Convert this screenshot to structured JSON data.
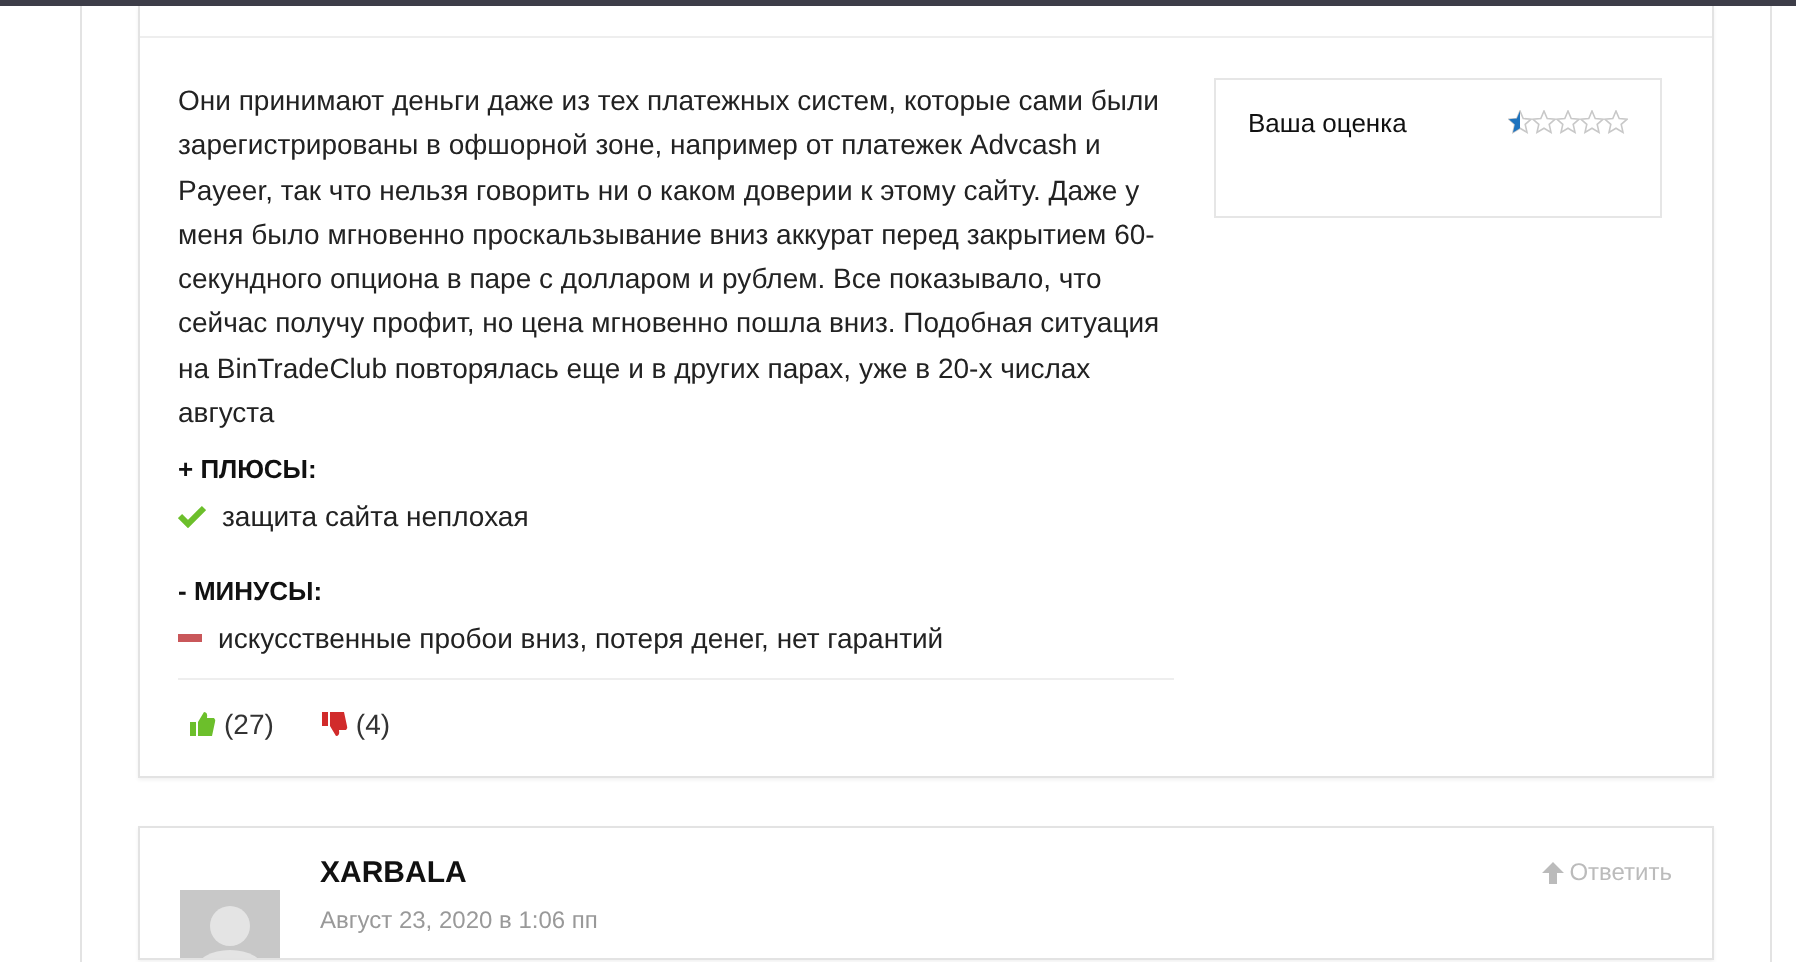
{
  "review": {
    "text": "Они принимают деньги даже из тех платежных систем, которые сами были зарегистрированы в офшорной зоне, например от платежек Advcash и Payeer, так что нельзя говорить ни о каком доверии к этому сайту. Даже у меня было мгновенно проскальзывание вниз аккурат перед закрытием 60-секундного опциона в паре с долларом и рублем. Все показывало, что сейчас получу профит, но цена мгновенно пошла вниз. Подобная ситуация на BinTradeClub повторялась еще и в других парах, уже в 20-х числах августа",
    "pros_heading": "+ ПЛЮСЫ:",
    "pros": [
      "защита сайта неплохая"
    ],
    "cons_heading": "- МИНУСЫ:",
    "cons": [
      "искусственные пробои вниз, потеря денег, нет гарантий"
    ],
    "likes": "(27)",
    "dislikes": "(4)",
    "rating": {
      "label": "Ваша оценка",
      "stars": 0.5
    }
  },
  "next_comment": {
    "author": "XARBALA",
    "date": "Август 23, 2020 в 1:06 пп",
    "reply": "Ответить"
  }
}
